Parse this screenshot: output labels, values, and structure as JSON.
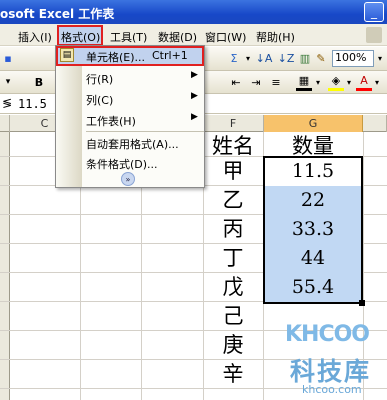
{
  "window": {
    "title": "osoft Excel 工作表"
  },
  "menubar": {
    "items": [
      "插入(I)",
      "格式(O)",
      "工具(T)",
      "数据(D)",
      "窗口(W)",
      "帮助(H)"
    ]
  },
  "toolbar": {
    "zoom": "100%",
    "bold": "B"
  },
  "formula_bar": {
    "value": "11.5"
  },
  "columns": [
    "C",
    "F",
    "G"
  ],
  "dropdown": {
    "items": [
      {
        "label": "单元格(E)...",
        "shortcut": "Ctrl+1"
      },
      {
        "label": "行(R)"
      },
      {
        "label": "列(C)"
      },
      {
        "label": "工作表(H)"
      },
      {
        "label": "自动套用格式(A)..."
      },
      {
        "label": "条件格式(D)..."
      }
    ]
  },
  "sheet": {
    "header_f": "姓名",
    "header_g": "数量",
    "names": [
      "甲",
      "乙",
      "丙",
      "丁",
      "戊",
      "己",
      "庚",
      "辛"
    ],
    "values": [
      "11.5",
      "22",
      "33.3",
      "44",
      "55.4"
    ]
  },
  "watermark": {
    "logo": "KHCOO",
    "cn": "科技库",
    "url": "khcoo.com"
  },
  "colors": {
    "selection": "#c1d8f3",
    "highlight_red": "#e02020",
    "active_col": "#f7c26b"
  }
}
